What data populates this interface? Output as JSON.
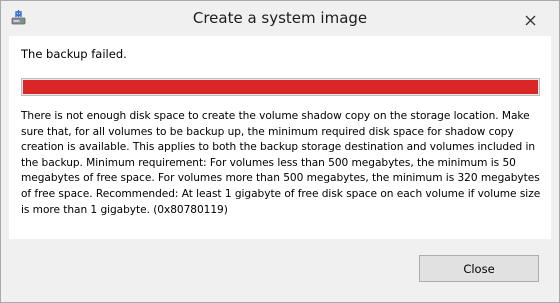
{
  "window": {
    "title": "Create a system image",
    "app_icon": "backup-drive-icon",
    "close_glyph": "✕"
  },
  "content": {
    "headline": "The backup failed.",
    "progress": {
      "fraction": 1.0,
      "color": "#da2626"
    },
    "message": "There is not enough disk space to create the volume shadow copy on the storage location. Make sure that, for all volumes to be backup up, the minimum required disk space for shadow copy creation is available. This applies to both the backup storage destination and volumes included in the backup. Minimum requirement: For volumes less than 500 megabytes, the minimum is 50 megabytes of free space. For volumes more than 500 megabytes, the minimum is 320 megabytes of free space.  Recommended: At least 1 gigabyte of free disk space on each volume if volume size is more than 1 gigabyte. (0x80780119)"
  },
  "footer": {
    "close_label": "Close"
  }
}
